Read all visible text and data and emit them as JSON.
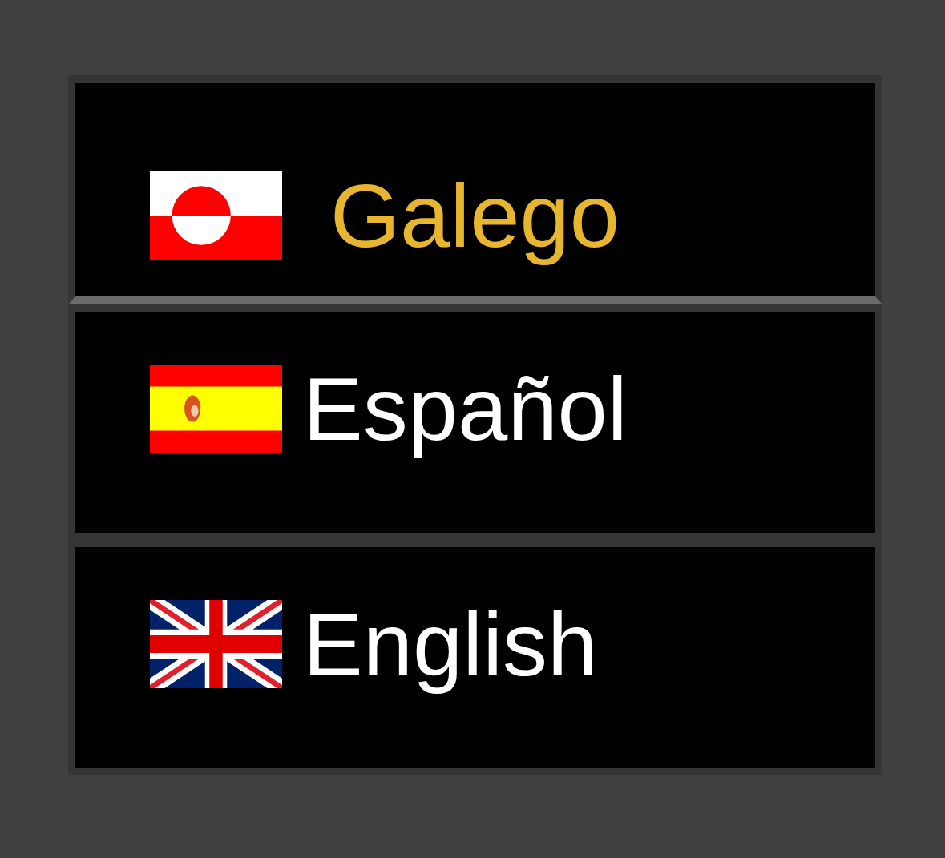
{
  "languages": [
    {
      "label": "Galego",
      "kind": "greenland",
      "selected": true
    },
    {
      "label": "Español",
      "kind": "spain",
      "selected": false
    },
    {
      "label": "English",
      "kind": "uk",
      "selected": false
    }
  ]
}
